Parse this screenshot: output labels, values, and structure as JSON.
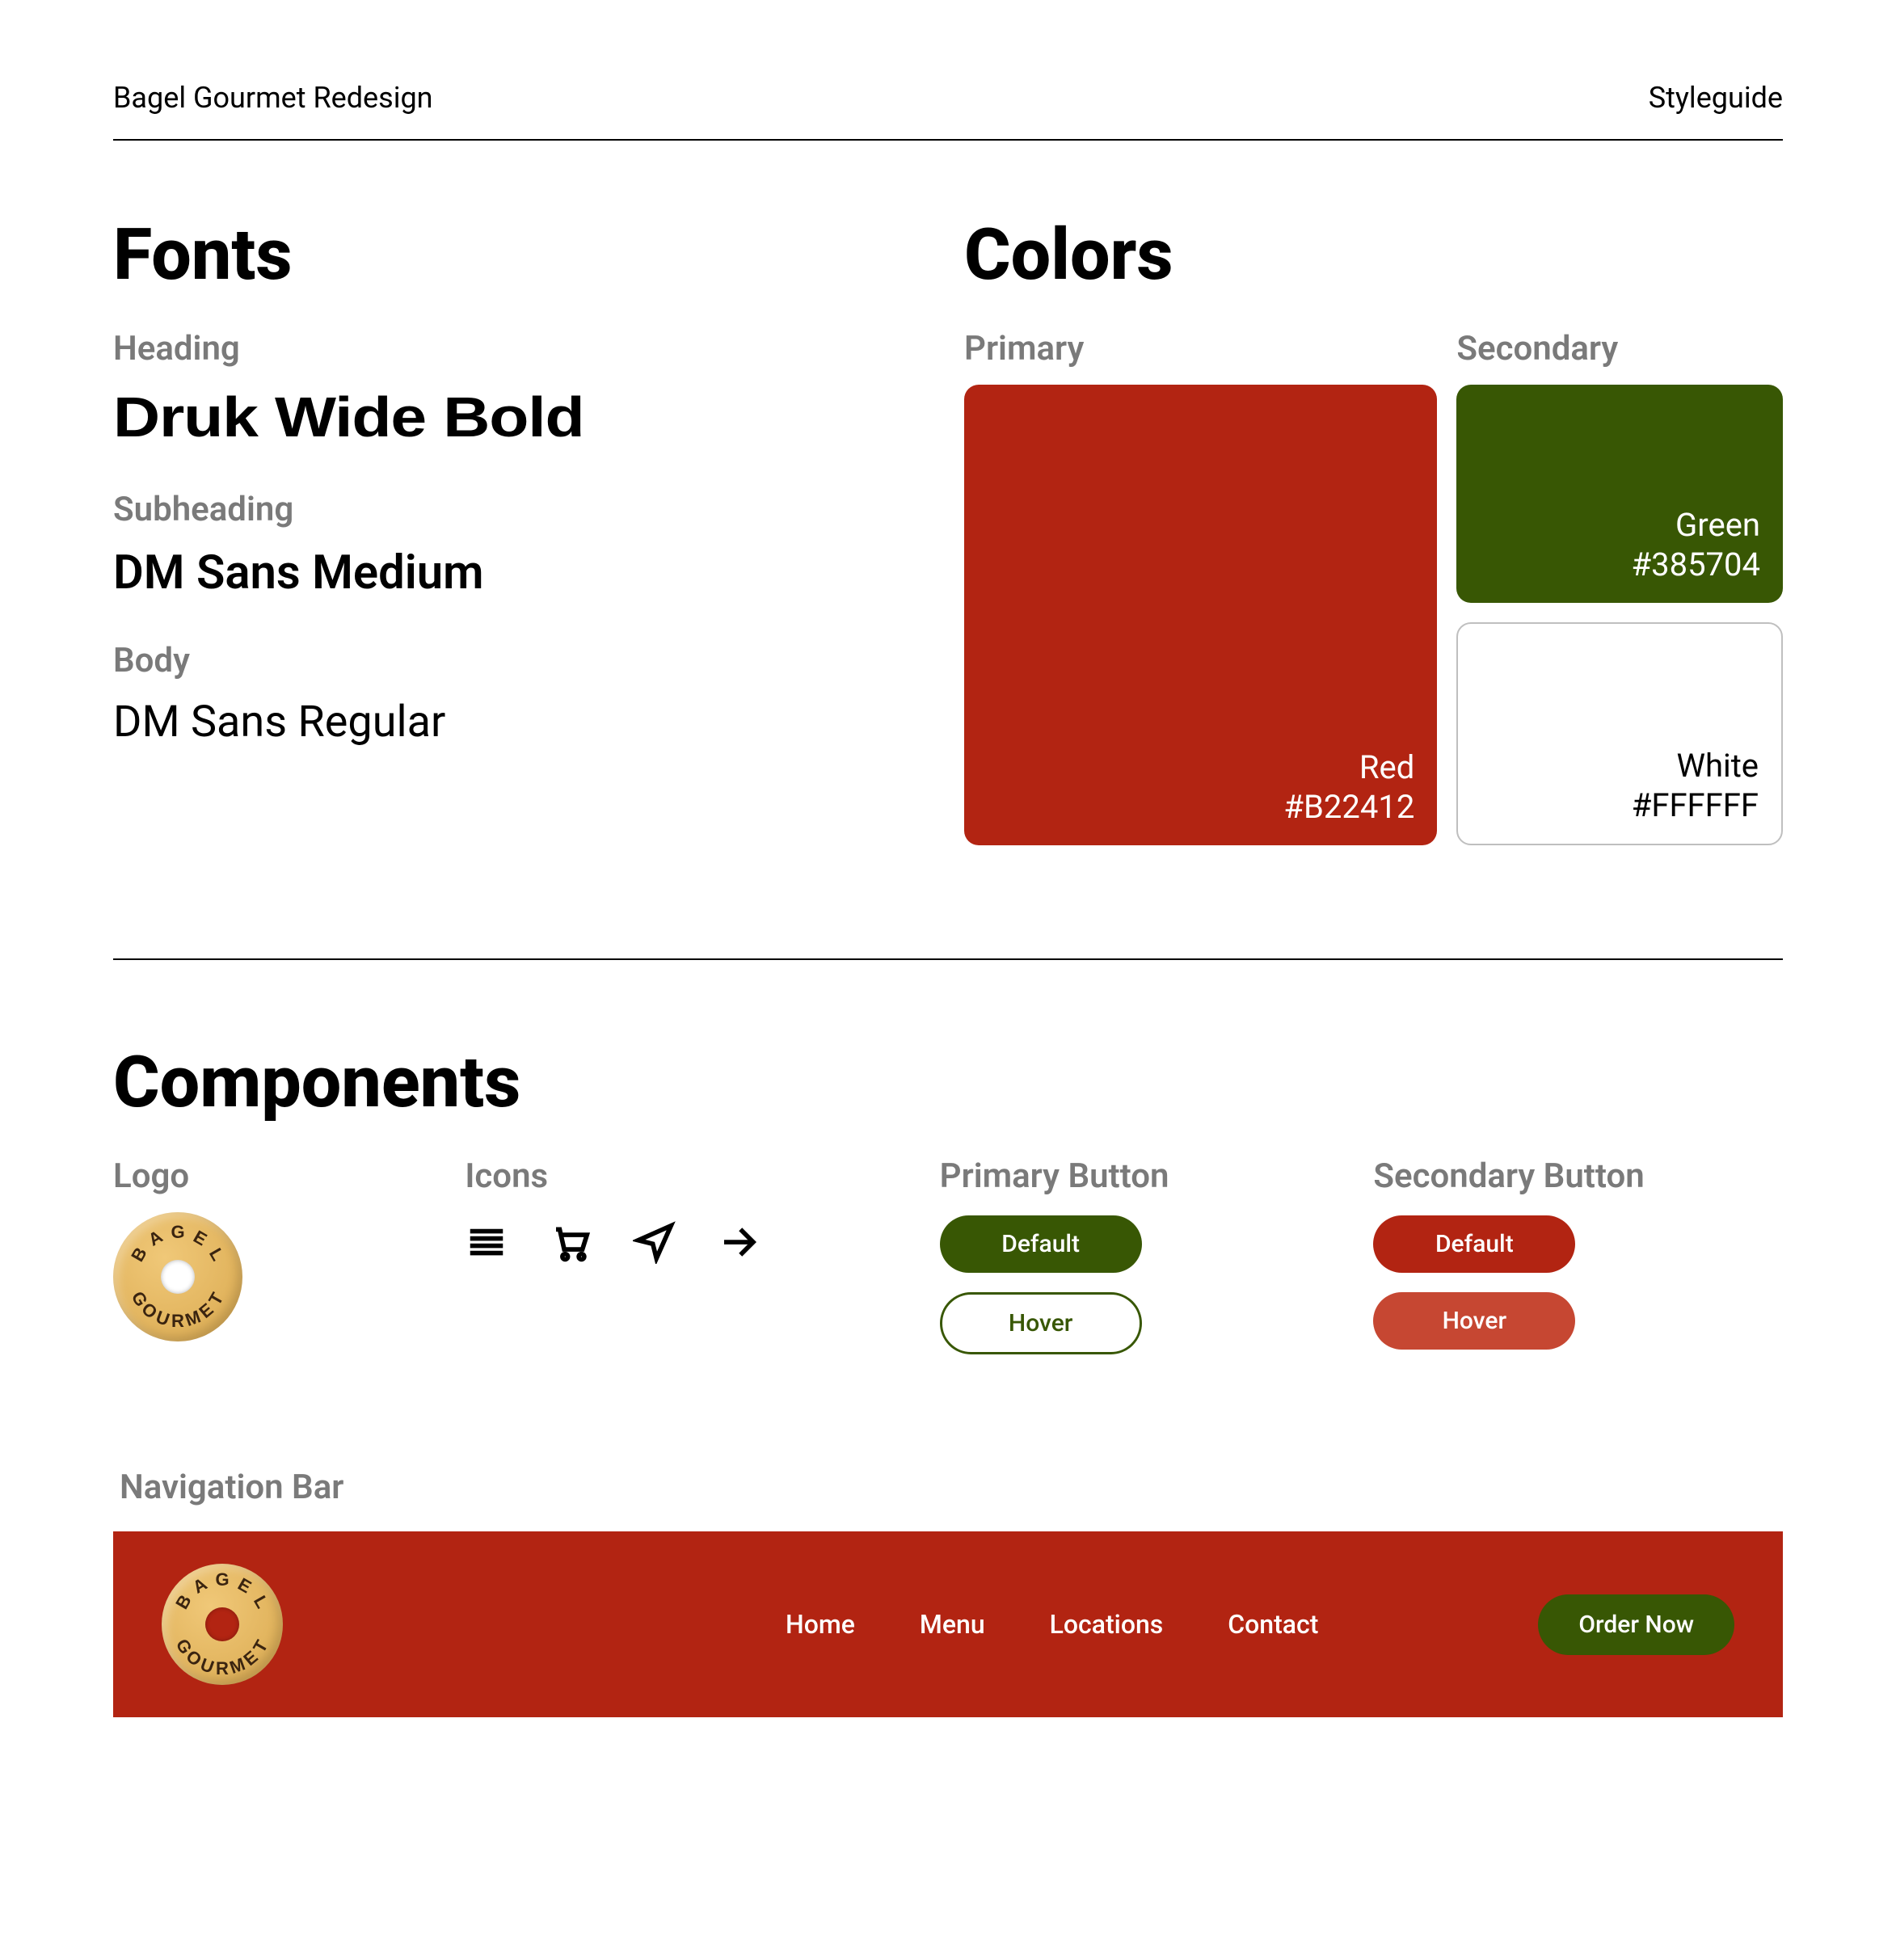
{
  "header": {
    "project": "Bagel Gourmet Redesign",
    "page": "Styleguide"
  },
  "fonts": {
    "title": "Fonts",
    "heading_label": "Heading",
    "heading_font": "Druk Wide Bold",
    "subheading_label": "Subheading",
    "subheading_font": "DM Sans Medium",
    "body_label": "Body",
    "body_font": "DM Sans Regular"
  },
  "colors": {
    "title": "Colors",
    "primary_label": "Primary",
    "secondary_label": "Secondary",
    "red": {
      "name": "Red",
      "hex": "#B22412"
    },
    "green": {
      "name": "Green",
      "hex": "#385704"
    },
    "white": {
      "name": "White",
      "hex": "#FFFFFF"
    }
  },
  "components": {
    "title": "Components",
    "logo_label": "Logo",
    "logo_text": "BAGEL GOURMET",
    "icons_label": "Icons",
    "icons": [
      "menu-icon",
      "cart-icon",
      "send-icon",
      "arrow-right-icon"
    ],
    "primary_button_label": "Primary Button",
    "primary_button": {
      "default": "Default",
      "hover": "Hover"
    },
    "secondary_button_label": "Secondary Button",
    "secondary_button": {
      "default": "Default",
      "hover": "Hover"
    }
  },
  "navbar": {
    "label": "Navigation Bar",
    "links": [
      "Home",
      "Menu",
      "Locations",
      "Contact"
    ],
    "cta": "Order Now"
  }
}
